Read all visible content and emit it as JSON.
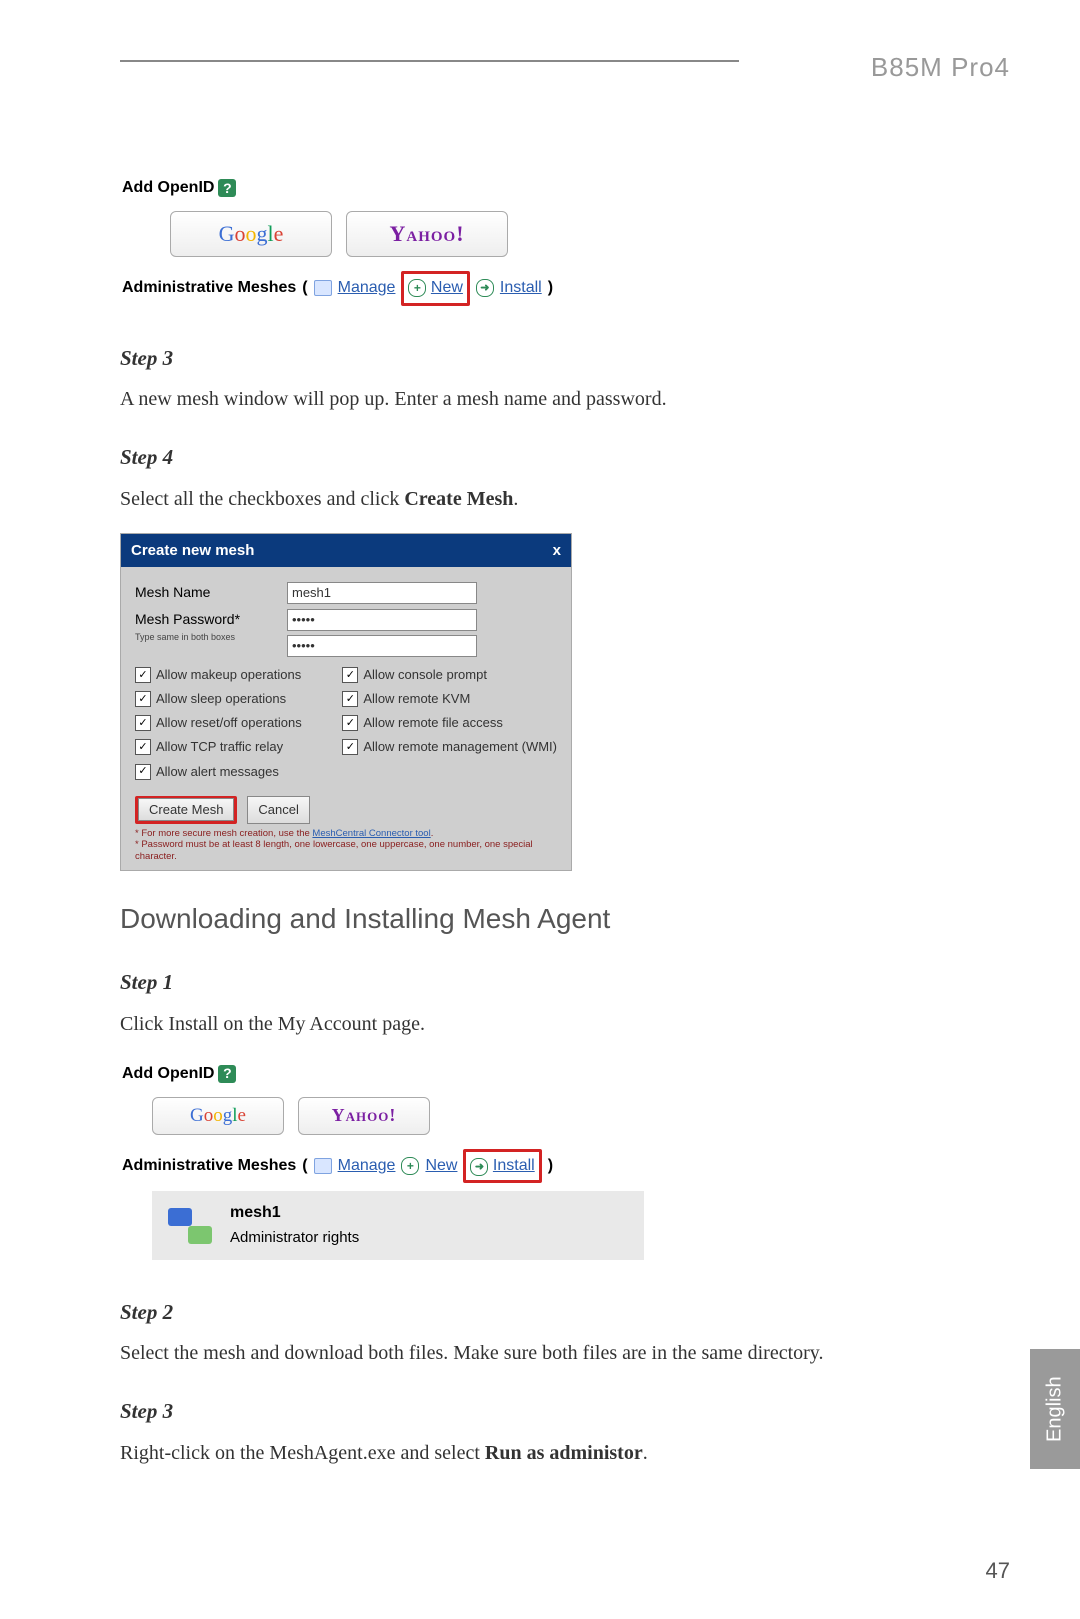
{
  "header": {
    "product": "B85M Pro4"
  },
  "side_tab": "English",
  "page_number": "47",
  "screenshot_account": {
    "add_openid": "Add OpenID",
    "providers": {
      "google": "Google",
      "yahoo": "Yahoo!"
    },
    "admin_label": "Administrative Meshes",
    "links": {
      "manage": "Manage",
      "new": "New",
      "install": "Install"
    },
    "mesh_entry": {
      "name": "mesh1",
      "rights": "Administrator rights"
    }
  },
  "step3a": {
    "label": "Step 3",
    "text": "A new mesh window will pop up. Enter a mesh name and password."
  },
  "step4": {
    "label": "Step 4",
    "text_pre": "Select all the checkboxes and click ",
    "text_bold": "Create Mesh",
    "text_post": "."
  },
  "dialog": {
    "title": "Create new mesh",
    "close": "x",
    "mesh_name_label": "Mesh Name",
    "mesh_name_value": "mesh1",
    "mesh_pw_label": "Mesh Password*",
    "mesh_pw_hint": "Type same in both boxes",
    "pw_value": "•••••",
    "checkboxes": {
      "c1": "Allow makeup operations",
      "c2": "Allow console prompt",
      "c3": "Allow sleep operations",
      "c4": "Allow remote KVM",
      "c5": "Allow reset/off operations",
      "c6": "Allow remote file access",
      "c7": "Allow TCP traffic relay",
      "c8": "Allow remote management (WMI)",
      "c9": "Allow alert messages"
    },
    "create_btn": "Create Mesh",
    "cancel_btn": "Cancel",
    "foot1_pre": "* For more secure mesh creation, use the ",
    "foot1_link": "MeshCentral Connector tool",
    "foot2": "* Password must be at least 8 length, one lowercase, one uppercase, one number, one special character."
  },
  "section2_title": "Downloading and Installing Mesh Agent",
  "step1b": {
    "label": "Step 1",
    "text": "Click Install on the My Account page."
  },
  "step2b": {
    "label": "Step 2",
    "text": "Select the mesh and download both files. Make sure both files are in the same directory."
  },
  "step3b": {
    "label": "Step 3",
    "text_pre": "Right-click on the MeshAgent.exe and select ",
    "text_bold": "Run as administor",
    "text_post": "."
  }
}
